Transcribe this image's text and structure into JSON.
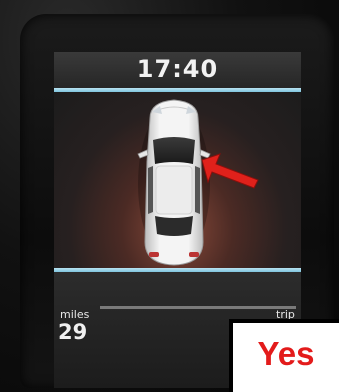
{
  "display": {
    "clock": "17:40",
    "odometer_label": "miles",
    "odometer_value": "29",
    "trip_label": "trip"
  },
  "annotation": {
    "text": "Yes",
    "color": "#e31b1b"
  },
  "icons": {
    "vehicle": "car-top-view-icon",
    "pointer": "red-arrow-icon"
  },
  "colors": {
    "accent_line": "#9fd4e8",
    "warning_glow": "#8a4a3a"
  }
}
